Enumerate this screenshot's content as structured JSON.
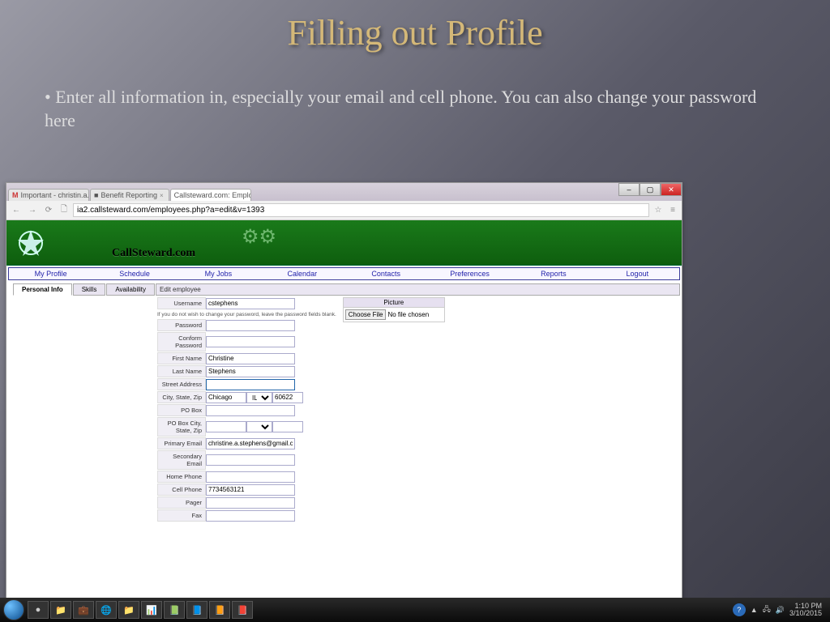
{
  "slide": {
    "title": "Filling out Profile",
    "bullet": "Enter all information in, especially your email and cell phone.  You can also change your password here"
  },
  "browser": {
    "tabs": [
      {
        "label": "Important - christin.a.st..",
        "icon": "M"
      },
      {
        "label": "Benefit Reporting",
        "icon": "■"
      },
      {
        "label": "Callsteward.com: Employ",
        "icon": ""
      }
    ],
    "url": "ia2.callsteward.com/employees.php?a=edit&v=1393",
    "banner_text": "CallSteward.com"
  },
  "menu": [
    "My Profile",
    "Schedule",
    "My Jobs",
    "Calendar",
    "Contacts",
    "Preferences",
    "Reports",
    "Logout"
  ],
  "subtabs": {
    "items": [
      "Personal Info",
      "Skills",
      "Availability"
    ],
    "active": 0,
    "header": "Edit employee"
  },
  "form": {
    "hint": "If you do not wish to change your password, leave the password fields blank.",
    "username_label": "Username",
    "username": "cstephens",
    "password_label": "Password",
    "password": "",
    "conform_label": "Conform Password",
    "conform": "",
    "first_label": "First Name",
    "first": "Christine",
    "last_label": "Last Name",
    "last": "Stephens",
    "street_label": "Street Address",
    "street": "",
    "csz_label": "City, State, Zip",
    "city": "Chicago",
    "state": "IL",
    "zip": "60622",
    "pobox_label": "PO Box",
    "pobox": "",
    "pocsz_label": "PO Box City, State, Zip",
    "pemail_label": "Primary Email",
    "pemail": "christine.a.stephens@gmail.com",
    "semail_label": "Secondary Email",
    "semail": "",
    "home_label": "Home Phone",
    "home": "",
    "cell_label": "Cell Phone",
    "cell": "7734563121",
    "pager_label": "Pager",
    "pager": "",
    "fax_label": "Fax",
    "fax": ""
  },
  "picture": {
    "header": "Picture",
    "choose": "Choose File",
    "nofile": "No file chosen"
  },
  "taskbar": {
    "time": "1:10 PM",
    "date": "3/10/2015",
    "tray_icons": [
      "?",
      "▲",
      "🖧",
      "🔊"
    ],
    "apps": [
      "●",
      "📁",
      "💼",
      "🌐",
      "📁",
      "📊",
      "📗",
      "📘",
      "📙",
      "📕"
    ]
  }
}
